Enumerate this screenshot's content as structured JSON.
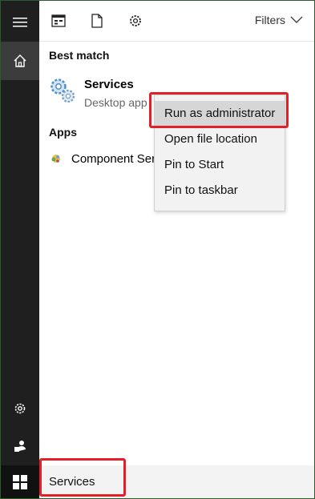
{
  "toolbar": {
    "filters_label": "Filters",
    "icons": [
      "calendar-grid-icon",
      "document-icon",
      "gear-icon",
      "chevron-down-icon"
    ]
  },
  "rail": {
    "icons": [
      "hamburger-menu-icon",
      "home-icon",
      "settings-gear-icon",
      "user-icon",
      "windows-start-icon"
    ]
  },
  "results": {
    "best_match_header": "Best match",
    "best_match": {
      "title": "Services",
      "subtitle": "Desktop app",
      "icon": "services-gears-icon"
    },
    "apps_header": "Apps",
    "apps": [
      {
        "label": "Component Services",
        "icon": "component-services-icon"
      }
    ]
  },
  "context_menu": {
    "items": [
      {
        "label": "Run as administrator",
        "highlighted": true
      },
      {
        "label": "Open file location"
      },
      {
        "label": "Pin to Start"
      },
      {
        "label": "Pin to taskbar"
      }
    ]
  },
  "search": {
    "value": "Services"
  },
  "colors": {
    "highlight_box": "#e1202a",
    "rail_bg": "#1f1f1f",
    "menu_bg": "#f2f2f2"
  }
}
